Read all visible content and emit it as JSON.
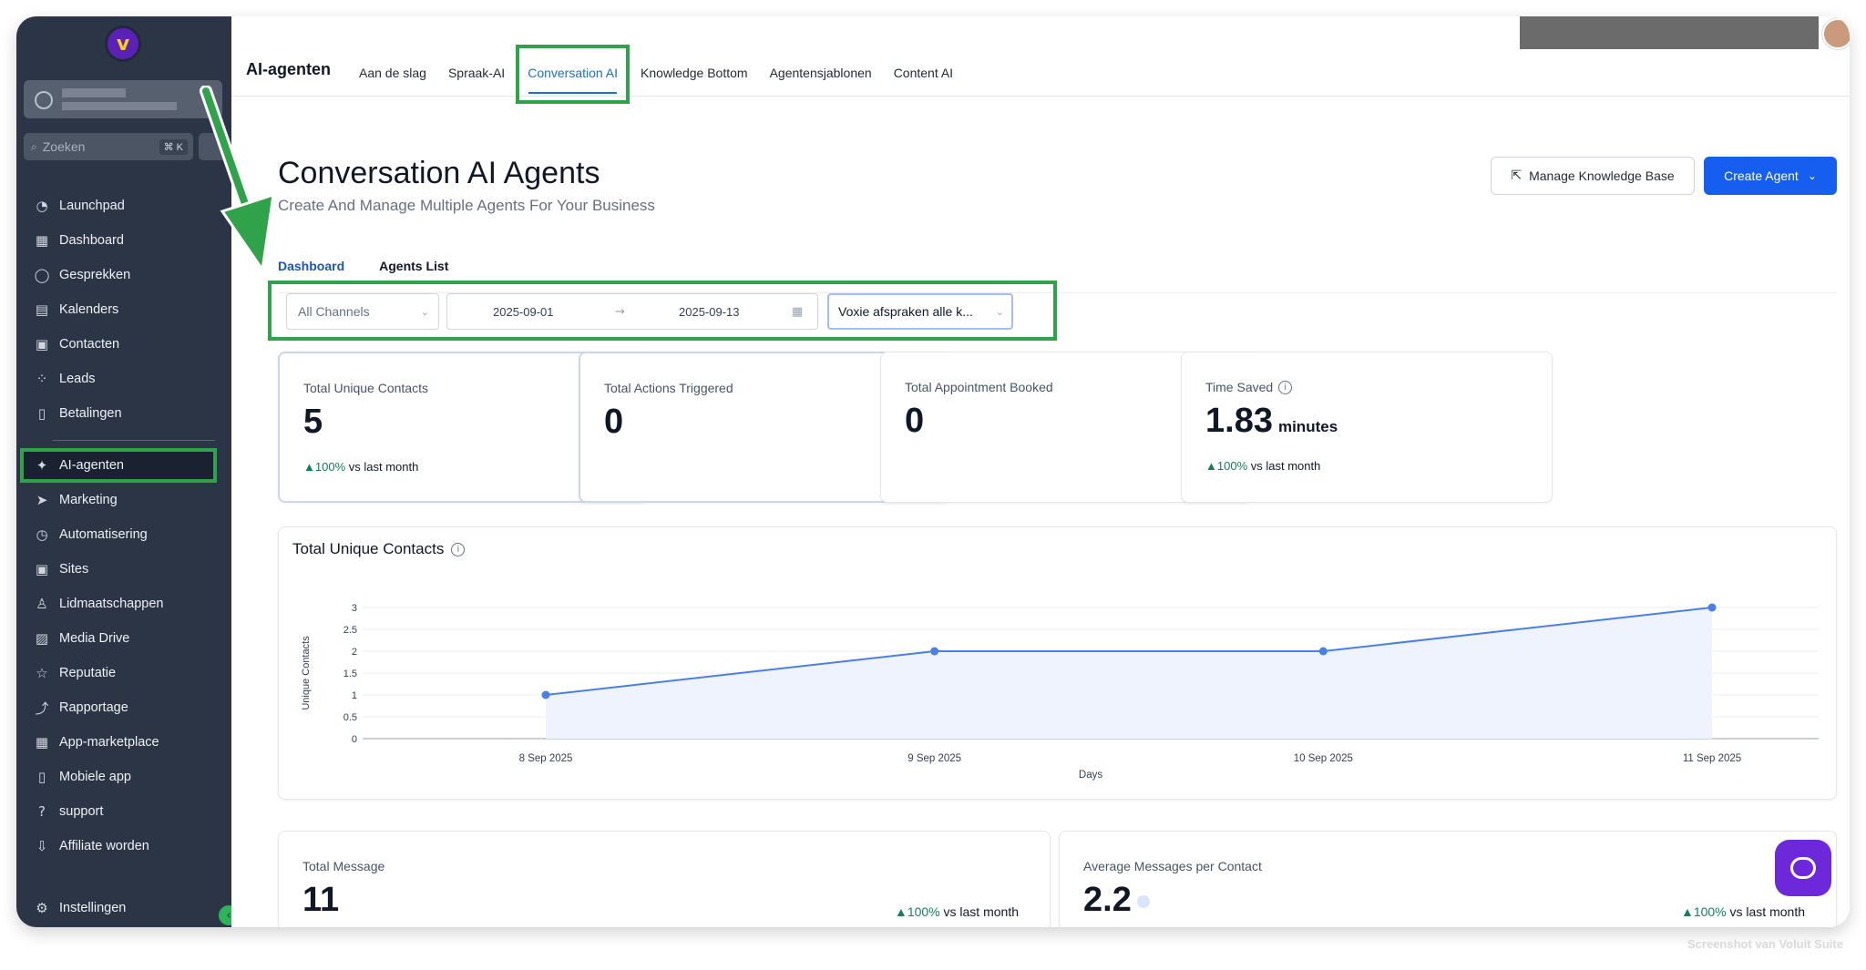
{
  "sidebar": {
    "search_placeholder": "Zoeken",
    "search_shortcut": "⌘ K",
    "items_top": [
      {
        "label": "Launchpad",
        "icon": "rocket-icon",
        "glyph": "◔"
      },
      {
        "label": "Dashboard",
        "icon": "grid-icon",
        "glyph": "▦"
      },
      {
        "label": "Gesprekken",
        "icon": "chat-icon",
        "glyph": "◯"
      },
      {
        "label": "Kalenders",
        "icon": "calendar-icon",
        "glyph": "▤"
      },
      {
        "label": "Contacten",
        "icon": "contacts-icon",
        "glyph": "▣"
      },
      {
        "label": "Leads",
        "icon": "leads-icon",
        "glyph": "⁘"
      },
      {
        "label": "Betalingen",
        "icon": "payments-icon",
        "glyph": "▯"
      }
    ],
    "items_bottom": [
      {
        "label": "AI-agenten",
        "icon": "sparkle-icon",
        "glyph": "✦",
        "active": true
      },
      {
        "label": "Marketing",
        "icon": "send-icon",
        "glyph": "➤"
      },
      {
        "label": "Automatisering",
        "icon": "automation-icon",
        "glyph": "◷"
      },
      {
        "label": "Sites",
        "icon": "sites-icon",
        "glyph": "▣"
      },
      {
        "label": "Lidmaatschappen",
        "icon": "membership-icon",
        "glyph": "♙"
      },
      {
        "label": "Media Drive",
        "icon": "media-icon",
        "glyph": "▨"
      },
      {
        "label": "Reputatie",
        "icon": "star-icon",
        "glyph": "☆"
      },
      {
        "label": "Rapportage",
        "icon": "reporting-icon",
        "glyph": "⤴"
      },
      {
        "label": "App-marketplace",
        "icon": "apps-icon",
        "glyph": "▦"
      },
      {
        "label": "Mobiele app",
        "icon": "mobile-icon",
        "glyph": "▯"
      },
      {
        "label": "support",
        "icon": "help-icon",
        "glyph": "?"
      },
      {
        "label": "Affiliate worden",
        "icon": "affiliate-icon",
        "glyph": "⇩"
      }
    ],
    "settings_label": "Instellingen"
  },
  "header": {
    "app_title": "AI-agenten",
    "tabs": [
      "Aan de slag",
      "Spraak-AI",
      "Conversation AI",
      "Knowledge Bottom",
      "Agentensjablonen",
      "Content AI"
    ],
    "active_tab": "Conversation AI"
  },
  "page": {
    "title": "Conversation AI Agents",
    "subtitle": "Create And Manage Multiple Agents For Your Business",
    "manage_kb_label": "Manage Knowledge Base",
    "create_agent_label": "Create Agent",
    "sub_tabs": [
      "Dashboard",
      "Agents List"
    ],
    "active_sub_tab": "Dashboard"
  },
  "filters": {
    "channel": "All Channels",
    "date_from": "2025-09-01",
    "date_to": "2025-09-13",
    "agent": "Voxie afspraken alle k..."
  },
  "stats": [
    {
      "label": "Total Unique Contacts",
      "value": "5",
      "unit": "",
      "delta": "100%",
      "delta_text": "vs last month",
      "info": false
    },
    {
      "label": "Total Actions Triggered",
      "value": "0",
      "unit": "",
      "delta": "",
      "delta_text": "",
      "info": false
    },
    {
      "label": "Total Appointment Booked",
      "value": "0",
      "unit": "",
      "delta": "",
      "delta_text": "",
      "info": false
    },
    {
      "label": "Time Saved",
      "value": "1.83",
      "unit": "minutes",
      "delta": "100%",
      "delta_text": "vs last month",
      "info": true
    }
  ],
  "chart_data": {
    "type": "area",
    "title": "Total Unique Contacts",
    "xlabel": "Days",
    "ylabel": "Unique Contacts",
    "categories": [
      "8 Sep 2025",
      "9 Sep 2025",
      "10 Sep 2025",
      "11 Sep 2025"
    ],
    "values": [
      1,
      2,
      2,
      3
    ],
    "ylim": [
      0,
      3
    ],
    "yticks": [
      "0",
      "0.5",
      "1",
      "1.5",
      "2",
      "2.5",
      "3"
    ],
    "grid": true,
    "color": "#4a7fe8"
  },
  "bottom_cards": [
    {
      "label": "Total Message",
      "value": "11",
      "delta": "100%",
      "delta_text": "vs last month"
    },
    {
      "label": "Average Messages per Contact",
      "value": "2.2",
      "delta": "100%",
      "delta_text": "vs last month"
    }
  ],
  "footer_note": "Screenshot van Voluit Suite",
  "colors": {
    "sidebar_bg": "#2b3546",
    "primary": "#155eef",
    "highlight": "#2fa24a",
    "positive": "#12805c",
    "support_button": "#6d28d9"
  }
}
